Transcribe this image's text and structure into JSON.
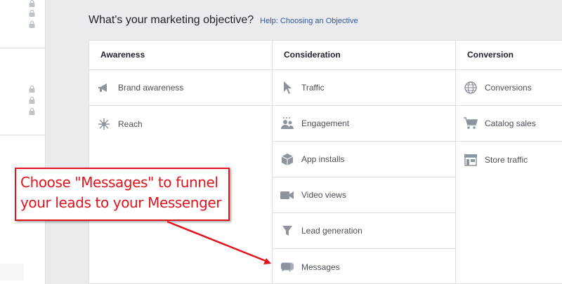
{
  "header": {
    "title": "What's your marketing objective?",
    "help_link": "Help: Choosing an Objective"
  },
  "columns": [
    {
      "heading": "Awareness",
      "items": [
        {
          "label": "Brand awareness",
          "icon": "megaphone-icon"
        },
        {
          "label": "Reach",
          "icon": "reach-icon"
        }
      ]
    },
    {
      "heading": "Consideration",
      "items": [
        {
          "label": "Traffic",
          "icon": "cursor-icon"
        },
        {
          "label": "Engagement",
          "icon": "people-icon"
        },
        {
          "label": "App installs",
          "icon": "box-icon"
        },
        {
          "label": "Video views",
          "icon": "video-camera-icon"
        },
        {
          "label": "Lead generation",
          "icon": "funnel-icon"
        },
        {
          "label": "Messages",
          "icon": "chat-bubbles-icon"
        }
      ]
    },
    {
      "heading": "Conversion",
      "items": [
        {
          "label": "Conversions",
          "icon": "globe-icon"
        },
        {
          "label": "Catalog sales",
          "icon": "shopping-cart-icon"
        },
        {
          "label": "Store traffic",
          "icon": "store-icon"
        }
      ]
    }
  ],
  "callout": {
    "line1": "Choose \"Messages\" to funnel",
    "line2": "your leads to your Messenger"
  },
  "colors": {
    "accent": "#e0141c",
    "link": "#365899",
    "icon": "#8d949e"
  }
}
